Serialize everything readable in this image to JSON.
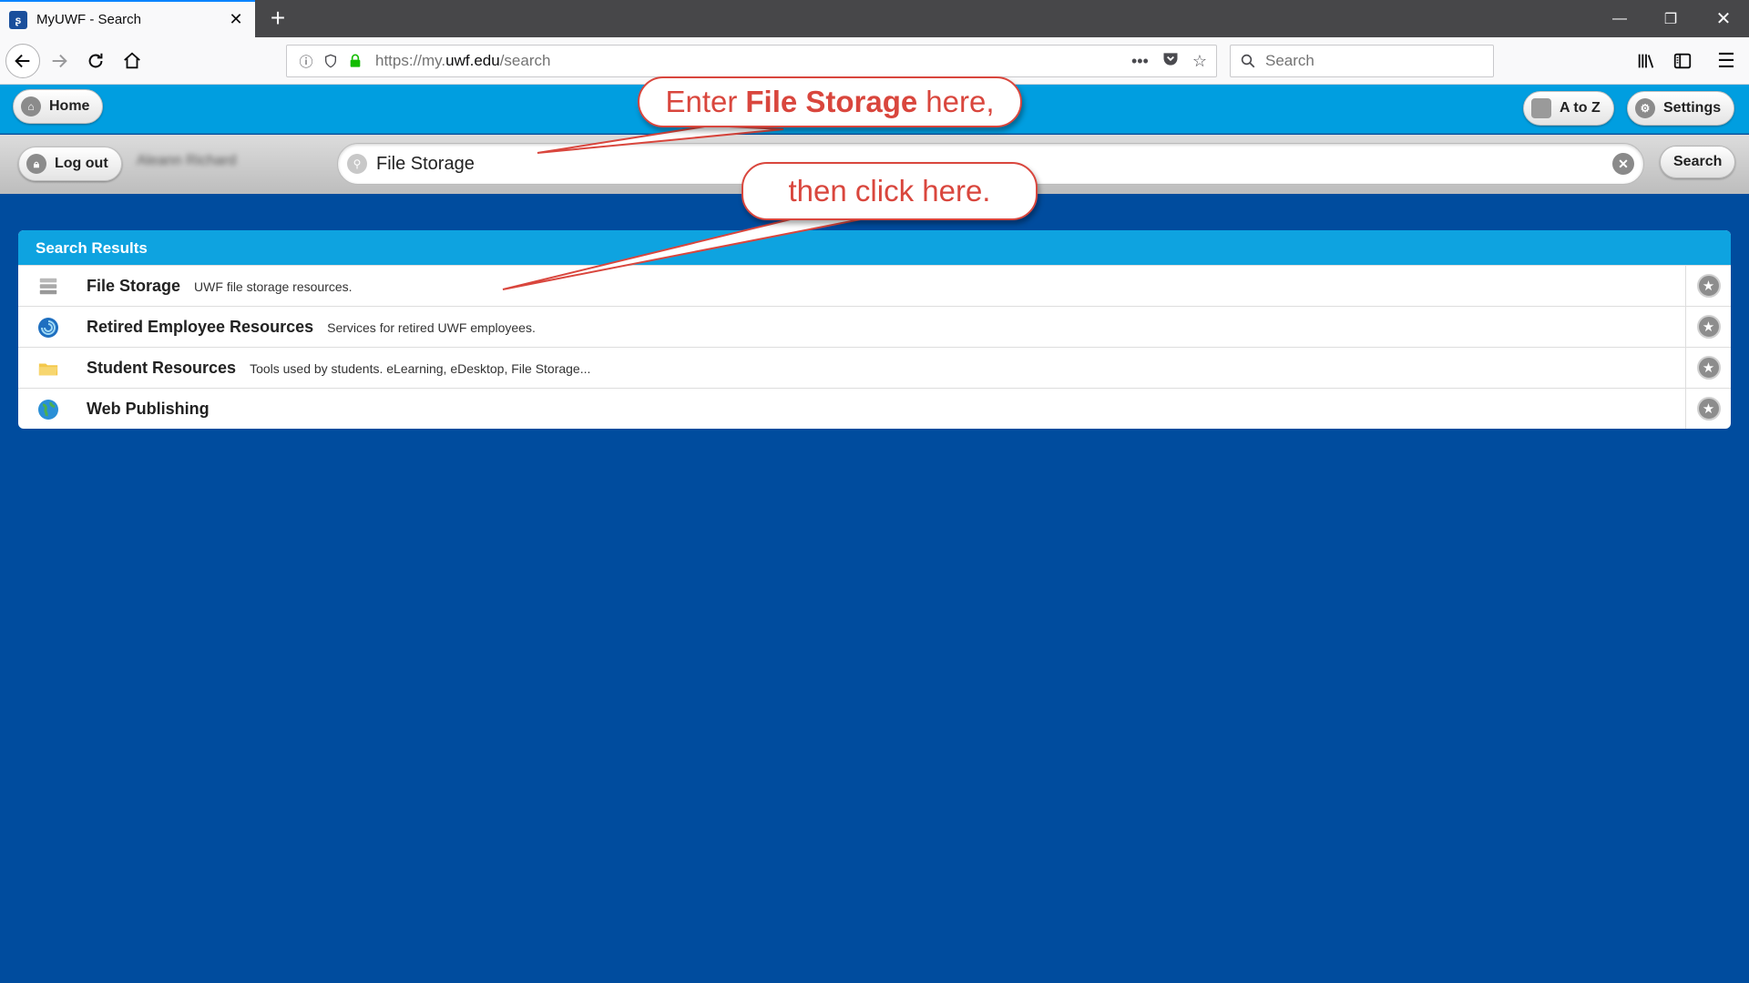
{
  "browser": {
    "tab_title": "MyUWF - Search",
    "tab_favicon": "uwf-logo-icon",
    "url_prefix": "https://my.",
    "url_domain": "uwf.edu",
    "url_path": "/search",
    "search_placeholder": "Search"
  },
  "header": {
    "home_label": "Home",
    "atoz_label": "A to Z",
    "settings_label": "Settings"
  },
  "subbar": {
    "logout_label": "Log out",
    "user_name": "Aleann Richard",
    "search_value": "File Storage",
    "search_button": "Search"
  },
  "results": {
    "heading": "Search Results",
    "items": [
      {
        "title": "File Storage",
        "description": "UWF file storage resources.",
        "icon": "server-stack-icon"
      },
      {
        "title": "Retired Employee Resources",
        "description": "Services for retired UWF employees.",
        "icon": "uwf-swirl-icon"
      },
      {
        "title": "Student Resources",
        "description": "Tools used by students. eLearning, eDesktop, File Storage...",
        "icon": "folder-icon"
      },
      {
        "title": "Web Publishing",
        "description": "",
        "icon": "globe-icon"
      }
    ]
  },
  "callouts": {
    "first_pre": "Enter",
    "first_bold": "File Storage",
    "first_post": "here,",
    "second": "then click here."
  },
  "colors": {
    "page_bg": "#004c9e",
    "header_bg": "#009ee0",
    "callout_red": "#d9463d"
  }
}
